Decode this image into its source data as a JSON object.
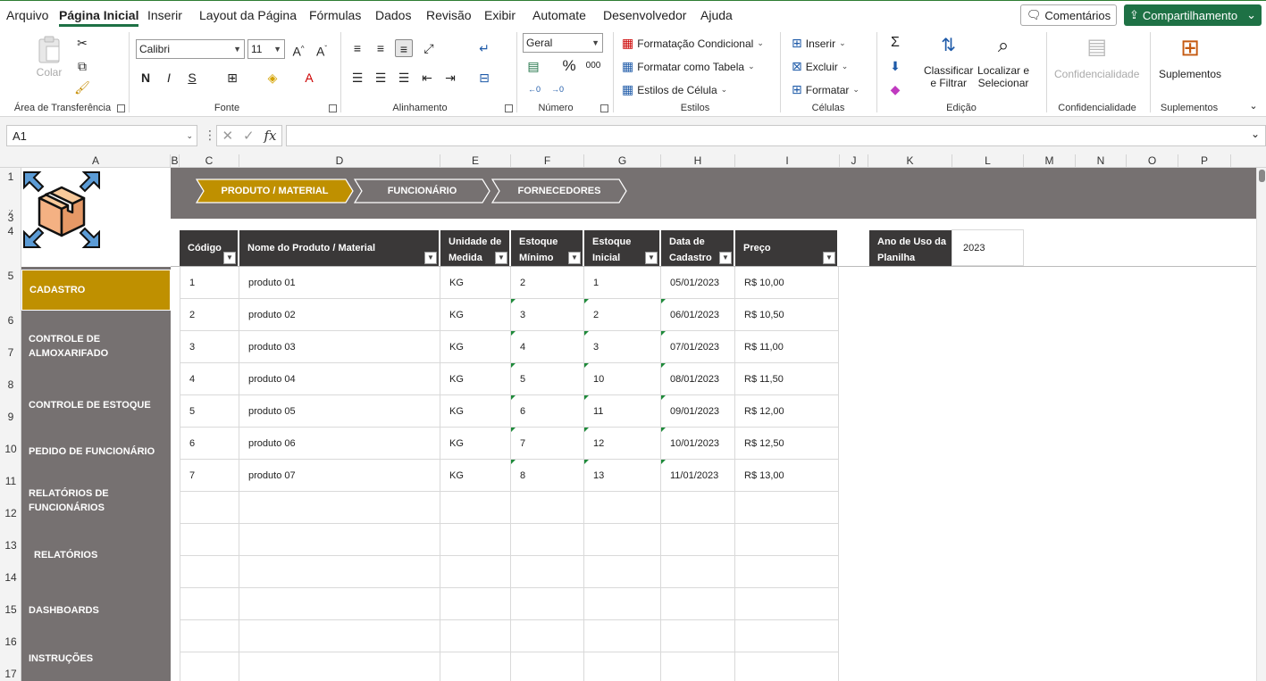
{
  "menu": {
    "items": [
      "Arquivo",
      "Página Inicial",
      "Inserir",
      "Layout da Página",
      "Fórmulas",
      "Dados",
      "Revisão",
      "Exibir",
      "Automate",
      "Desenvolvedor",
      "Ajuda"
    ],
    "active_index": 1,
    "comments_label": "Comentários",
    "share_label": "Compartilhamento"
  },
  "ribbon": {
    "paste_label": "Colar",
    "font_name": "Calibri",
    "font_size": "11",
    "bold": "N",
    "italic": "I",
    "underline": "S",
    "number_format": "Geral",
    "percent": "%",
    "thousands": "000",
    "cond_format": "Formatação Condicional",
    "format_table": "Formatar como Tabela",
    "cell_styles": "Estilos de Célula",
    "insert": "Inserir",
    "delete": "Excluir",
    "format": "Formatar",
    "sort_filter_1": "Classificar",
    "sort_filter_2": "e Filtrar",
    "find_select_1": "Localizar e",
    "find_select_2": "Selecionar",
    "sensitivity": "Confidencialidade",
    "addins": "Suplementos",
    "groups": {
      "clipboard": "Área de Transferência",
      "font": "Fonte",
      "alignment": "Alinhamento",
      "number": "Número",
      "styles": "Estilos",
      "cells": "Células",
      "editing": "Edição",
      "sensitivity": "Confidencialidade",
      "addins": "Suplementos"
    }
  },
  "formula_bar": {
    "name_box": "A1",
    "fx": "fx",
    "value": ""
  },
  "columns": [
    "A",
    "B",
    "C",
    "D",
    "E",
    "F",
    "G",
    "H",
    "I",
    "J",
    "K",
    "L",
    "M",
    "N",
    "O",
    "P"
  ],
  "rows": [
    "1",
    "2",
    "3",
    "4",
    "5",
    "6",
    "7",
    "8",
    "9",
    "10",
    "11",
    "12",
    "13",
    "14",
    "15",
    "16",
    "17"
  ],
  "tabs": [
    "PRODUTO / MATERIAL",
    "FUNCIONÁRIO",
    "FORNECEDORES"
  ],
  "sidebar": [
    {
      "lines": [
        "CADASTRO"
      ],
      "active": true
    },
    {
      "lines": [
        "CONTROLE DE",
        "ALMOXARIFADO"
      ],
      "active": false
    },
    {
      "lines": [
        "CONTROLE DE ESTOQUE"
      ],
      "active": false
    },
    {
      "lines": [
        "PEDIDO DE FUNCIONÁRIO"
      ],
      "active": false
    },
    {
      "lines": [
        "RELATÓRIOS DE",
        "FUNCIONÁRIOS"
      ],
      "active": false
    },
    {
      "lines": [
        "RELATÓRIOS"
      ],
      "active": false
    },
    {
      "lines": [
        "DASHBOARDS"
      ],
      "active": false
    },
    {
      "lines": [
        "INSTRUÇÕES"
      ],
      "active": false
    }
  ],
  "table": {
    "headers": [
      [
        "Código"
      ],
      [
        "Nome do Produto / Material"
      ],
      [
        "Unidade de",
        "Medida"
      ],
      [
        "Estoque",
        "Mínimo"
      ],
      [
        "Estoque",
        "Inicial"
      ],
      [
        "Data de",
        "Cadastro"
      ],
      [
        "Preço"
      ]
    ],
    "rows": [
      [
        "1",
        "produto 01",
        "KG",
        "2",
        "1",
        "05/01/2023",
        "R$ 10,00"
      ],
      [
        "2",
        "produto 02",
        "KG",
        "3",
        "2",
        "06/01/2023",
        "R$ 10,50"
      ],
      [
        "3",
        "produto 03",
        "KG",
        "4",
        "3",
        "07/01/2023",
        "R$ 11,00"
      ],
      [
        "4",
        "produto 04",
        "KG",
        "5",
        "10",
        "08/01/2023",
        "R$ 11,50"
      ],
      [
        "5",
        "produto 05",
        "KG",
        "6",
        "11",
        "09/01/2023",
        "R$ 12,00"
      ],
      [
        "6",
        "produto 06",
        "KG",
        "7",
        "12",
        "10/01/2023",
        "R$ 12,50"
      ],
      [
        "7",
        "produto 07",
        "KG",
        "8",
        "13",
        "11/01/2023",
        "R$ 13,00"
      ]
    ],
    "empty_rows": 6
  },
  "year": {
    "label_lines": [
      "Ano de Uso da",
      "Planilha"
    ],
    "value": "2023"
  },
  "colors": {
    "accent_gold": "#bf9000",
    "sidebar_gray": "#767171",
    "header_dark": "#3a3838",
    "excel_green": "#1e7145"
  }
}
